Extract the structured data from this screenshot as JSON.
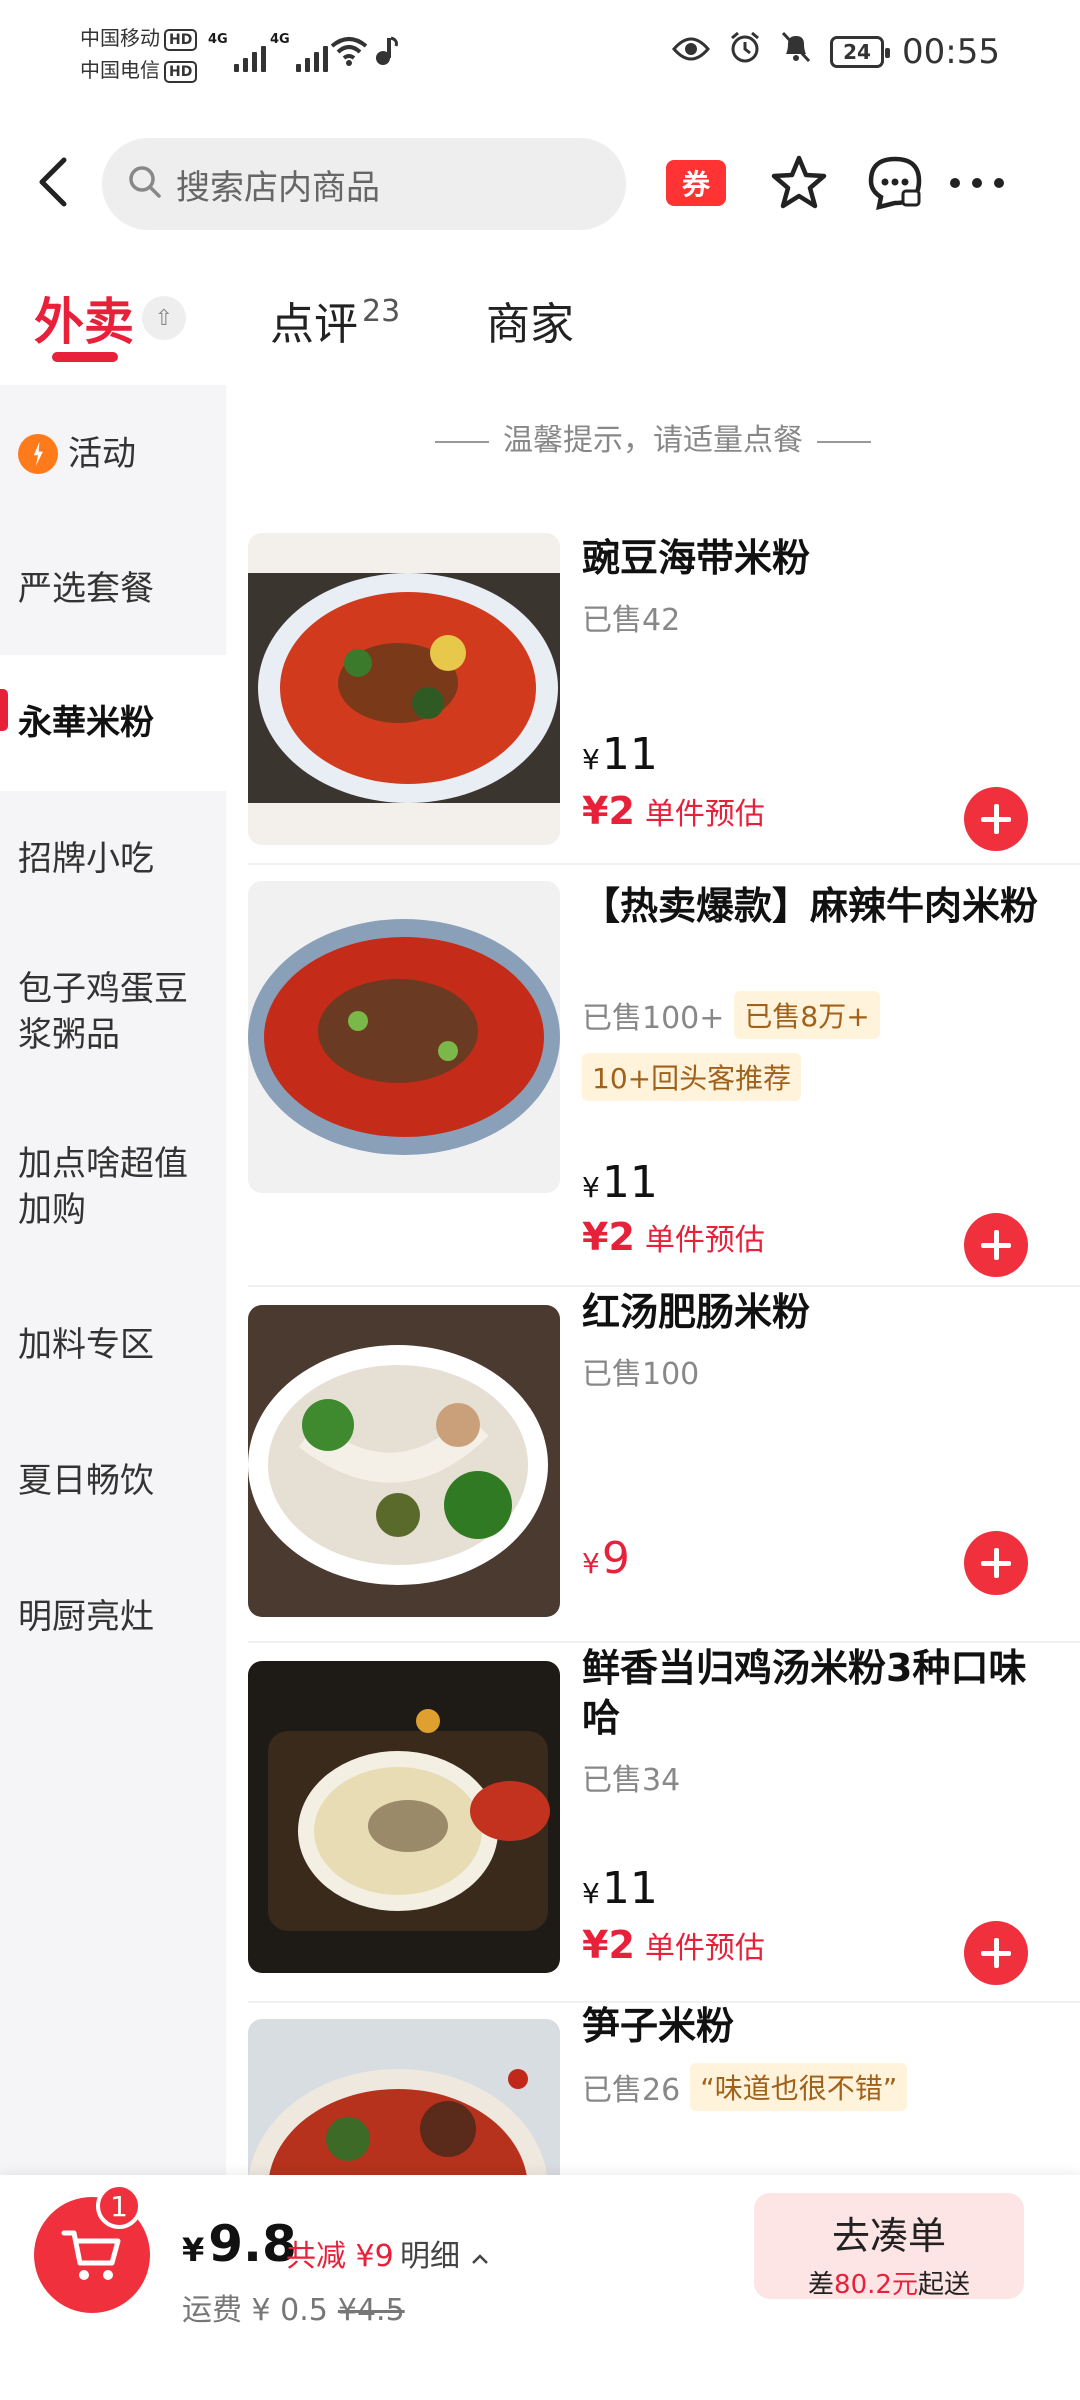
{
  "status_bar": {
    "carrier1": "中国移动",
    "carrier2": "中国电信",
    "hd": "HD",
    "net1": "4G",
    "net2": "4G",
    "battery": "24",
    "time": "00:55"
  },
  "header": {
    "search_placeholder": "搜索店内商品",
    "coupon_label": "券"
  },
  "tabs": [
    {
      "label": "外卖",
      "active": true
    },
    {
      "label": "点评",
      "count": "23"
    },
    {
      "label": "商家"
    }
  ],
  "sidebar": {
    "items": [
      {
        "label": "活动"
      },
      {
        "label": "严选套餐"
      },
      {
        "label": "永華米粉",
        "active": true
      },
      {
        "label": "招牌小吃"
      },
      {
        "label": "包子鸡蛋豆浆粥品"
      },
      {
        "label": "加点啥超值加购"
      },
      {
        "label": "加料专区"
      },
      {
        "label": "夏日畅饮"
      },
      {
        "label": "明厨亮灶"
      }
    ]
  },
  "tip": "温馨提示，请适量点餐",
  "currency": "¥",
  "products": [
    {
      "name": "豌豆海带米粉",
      "sold": "已售42",
      "price": "11",
      "est_price": "¥2",
      "est_label": "单件预估"
    },
    {
      "name": "【热卖爆款】麻辣牛肉米粉",
      "sold": "已售100+",
      "tag1": "已售8万+",
      "tag2": "10+回头客推荐",
      "price": "11",
      "est_price": "¥2",
      "est_label": "单件预估"
    },
    {
      "name": "红汤肥肠米粉",
      "sold": "已售100",
      "price": "9"
    },
    {
      "name": "鲜香当归鸡汤米粉3种口味哈",
      "sold": "已售34",
      "price": "11",
      "est_price": "¥2",
      "est_label": "单件预估"
    },
    {
      "name": "笋子米粉",
      "sold": "已售26",
      "tag1": "“味道也很不错”"
    }
  ],
  "cart": {
    "badge": "1",
    "total": "9.8",
    "discount": "共减 ¥9",
    "detail": "明细",
    "fee_label": "运费 ¥ 0.5",
    "fee_original": "¥4.5",
    "checkout_label": "去凑单",
    "min_prefix": "差",
    "min_amount": "80.2元",
    "min_suffix": "起送"
  },
  "colors": {
    "accent": "#e8213b",
    "add_button": "#f0313d",
    "tag_bg": "#fff3dc"
  },
  "icons": [
    "back-arrow-icon",
    "search-icon",
    "coupon-icon",
    "star-icon",
    "chat-icon",
    "more-icon",
    "fold-icon",
    "flame-icon",
    "plus-icon",
    "cart-icon",
    "chevron-up-icon"
  ]
}
